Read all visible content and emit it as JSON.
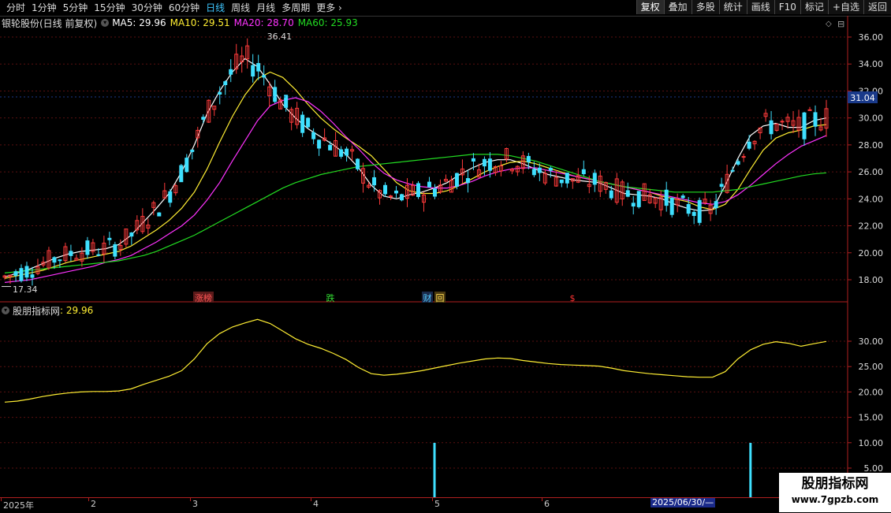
{
  "toolbar": {
    "periods": [
      "分时",
      "1分钟",
      "5分钟",
      "15分钟",
      "30分钟",
      "60分钟",
      "日线",
      "周线",
      "月线",
      "多周期",
      "更多"
    ],
    "active_period": "日线",
    "actions": [
      "复权",
      "叠加",
      "多股",
      "统计",
      "画线",
      "F10",
      "标记",
      "+自选",
      "返回"
    ]
  },
  "legend": {
    "stock": "银轮股份(日线 前复权)",
    "ma5": "MA5: 29.96",
    "ma10": "MA10: 29.51",
    "ma20": "MA20: 28.70",
    "ma60": "MA60: 25.93"
  },
  "sub_legend": {
    "label": "股朋指标网",
    "value": ": 29.96"
  },
  "annotations": {
    "high": "36.41",
    "low": "17.34",
    "current_price": "31.04",
    "events": [
      "涨榜",
      "跌",
      "财",
      "回",
      "$"
    ]
  },
  "xaxis": {
    "labels": [
      "2025年",
      "2",
      "3",
      "4",
      "5",
      "6"
    ],
    "selected_date": "2025/06/30/—"
  },
  "watermark": {
    "title": "股朋指标网",
    "url": "www.7gpzb.com"
  },
  "colors": {
    "up": "#ff3b3b",
    "down": "#3fe0ff",
    "ma5": "#ffffff",
    "ma10": "#ffee33",
    "ma20": "#ff33ff",
    "ma60": "#22dd22",
    "axis": "#b02020",
    "indicator": "#ffee33"
  },
  "chart_data": [
    {
      "type": "candlestick",
      "ylim": [
        16.5,
        37.5
      ],
      "y_ticks": [
        "36.00",
        "34.00",
        "32.00",
        "30.00",
        "28.00",
        "26.00",
        "24.00",
        "22.00",
        "20.00",
        "18.00"
      ],
      "series": [
        {
          "name": "MA5",
          "values": [
            18.2,
            18.5,
            18.8,
            19.2,
            19.6,
            19.9,
            20.1,
            20.2,
            20.3,
            20.6,
            21.3,
            22.3,
            23.3,
            24.4,
            26.0,
            28.0,
            30.3,
            32.0,
            33.4,
            34.4,
            33.8,
            32.5,
            31.0,
            30.0,
            29.2,
            28.6,
            28.0,
            27.3,
            26.3,
            25.0,
            24.2,
            24.0,
            24.3,
            24.5,
            24.8,
            25.2,
            25.8,
            26.3,
            26.7,
            26.9,
            26.9,
            26.6,
            26.2,
            25.8,
            25.6,
            25.4,
            25.3,
            25.2,
            24.8,
            24.4,
            24.3,
            24.2,
            24.0,
            23.6,
            23.3,
            23.1,
            23.2,
            25.0,
            27.0,
            28.7,
            29.4,
            29.6,
            29.3,
            29.3,
            29.8,
            30.0
          ]
        },
        {
          "name": "MA10",
          "values": [
            18.1,
            18.3,
            18.5,
            18.7,
            19.0,
            19.3,
            19.5,
            19.7,
            19.9,
            20.1,
            20.5,
            21.1,
            21.7,
            22.4,
            23.3,
            24.5,
            26.2,
            28.2,
            30.1,
            31.7,
            32.9,
            33.4,
            33.0,
            32.1,
            31.0,
            30.0,
            29.2,
            28.5,
            27.9,
            27.2,
            26.2,
            25.2,
            24.6,
            24.4,
            24.4,
            24.6,
            25.0,
            25.5,
            26.0,
            26.4,
            26.7,
            26.8,
            26.6,
            26.3,
            26.0,
            25.7,
            25.5,
            25.3,
            25.1,
            24.9,
            24.7,
            24.5,
            24.2,
            24.0,
            23.8,
            23.4,
            23.2,
            23.6,
            24.7,
            26.2,
            27.6,
            28.5,
            28.9,
            29.1,
            29.4,
            29.51
          ]
        },
        {
          "name": "MA20",
          "values": [
            17.8,
            17.9,
            18.0,
            18.2,
            18.4,
            18.6,
            18.8,
            19.0,
            19.3,
            19.5,
            19.8,
            20.3,
            20.8,
            21.4,
            22.0,
            22.8,
            23.9,
            25.2,
            26.8,
            28.3,
            29.8,
            30.9,
            31.3,
            31.5,
            31.2,
            30.5,
            29.6,
            28.6,
            27.7,
            26.7,
            25.9,
            25.4,
            25.1,
            24.9,
            24.8,
            24.8,
            25.0,
            25.3,
            25.7,
            26.0,
            26.2,
            26.3,
            26.3,
            26.1,
            25.9,
            25.7,
            25.5,
            25.3,
            25.1,
            24.9,
            24.7,
            24.5,
            24.3,
            24.1,
            23.9,
            23.7,
            23.6,
            23.8,
            24.3,
            25.0,
            25.8,
            26.6,
            27.3,
            27.9,
            28.3,
            28.7
          ]
        },
        {
          "name": "MA60",
          "values": [
            18.5,
            18.6,
            18.7,
            18.8,
            18.9,
            19.0,
            19.1,
            19.2,
            19.3,
            19.4,
            19.6,
            19.8,
            20.1,
            20.5,
            20.9,
            21.3,
            21.8,
            22.3,
            22.8,
            23.3,
            23.8,
            24.3,
            24.8,
            25.2,
            25.5,
            25.8,
            26.0,
            26.2,
            26.4,
            26.5,
            26.6,
            26.7,
            26.8,
            26.9,
            27.0,
            27.1,
            27.2,
            27.3,
            27.3,
            27.3,
            27.2,
            27.0,
            26.8,
            26.5,
            26.2,
            25.9,
            25.6,
            25.3,
            25.1,
            24.9,
            24.8,
            24.7,
            24.6,
            24.5,
            24.5,
            24.5,
            24.5,
            24.6,
            24.7,
            24.9,
            25.1,
            25.3,
            25.5,
            25.7,
            25.85,
            25.93
          ]
        }
      ]
    },
    {
      "type": "line",
      "ylim": [
        4.0,
        35.5
      ],
      "y_ticks": [
        "30.00",
        "25.00",
        "20.00",
        "15.00",
        "10.00",
        "5.00"
      ],
      "series": [
        {
          "name": "股朋指标网",
          "values": [
            18.0,
            18.2,
            18.6,
            19.1,
            19.5,
            19.8,
            20.0,
            20.1,
            20.1,
            20.2,
            20.6,
            21.5,
            22.3,
            23.1,
            24.2,
            26.5,
            29.5,
            31.5,
            32.8,
            33.6,
            34.3,
            33.5,
            32.0,
            30.5,
            29.4,
            28.6,
            27.6,
            26.4,
            24.8,
            23.6,
            23.3,
            23.5,
            23.8,
            24.2,
            24.7,
            25.2,
            25.7,
            26.1,
            26.5,
            26.7,
            26.6,
            26.2,
            25.9,
            25.6,
            25.4,
            25.3,
            25.2,
            25.1,
            24.7,
            24.2,
            23.9,
            23.6,
            23.4,
            23.2,
            23.0,
            22.9,
            22.9,
            24.0,
            26.5,
            28.3,
            29.4,
            29.9,
            29.6,
            29.0,
            29.5,
            29.96
          ]
        }
      ],
      "bars": [
        {
          "x_index": 34,
          "value": 10.0
        },
        {
          "x_index": 59,
          "value": 10.0
        }
      ]
    }
  ]
}
